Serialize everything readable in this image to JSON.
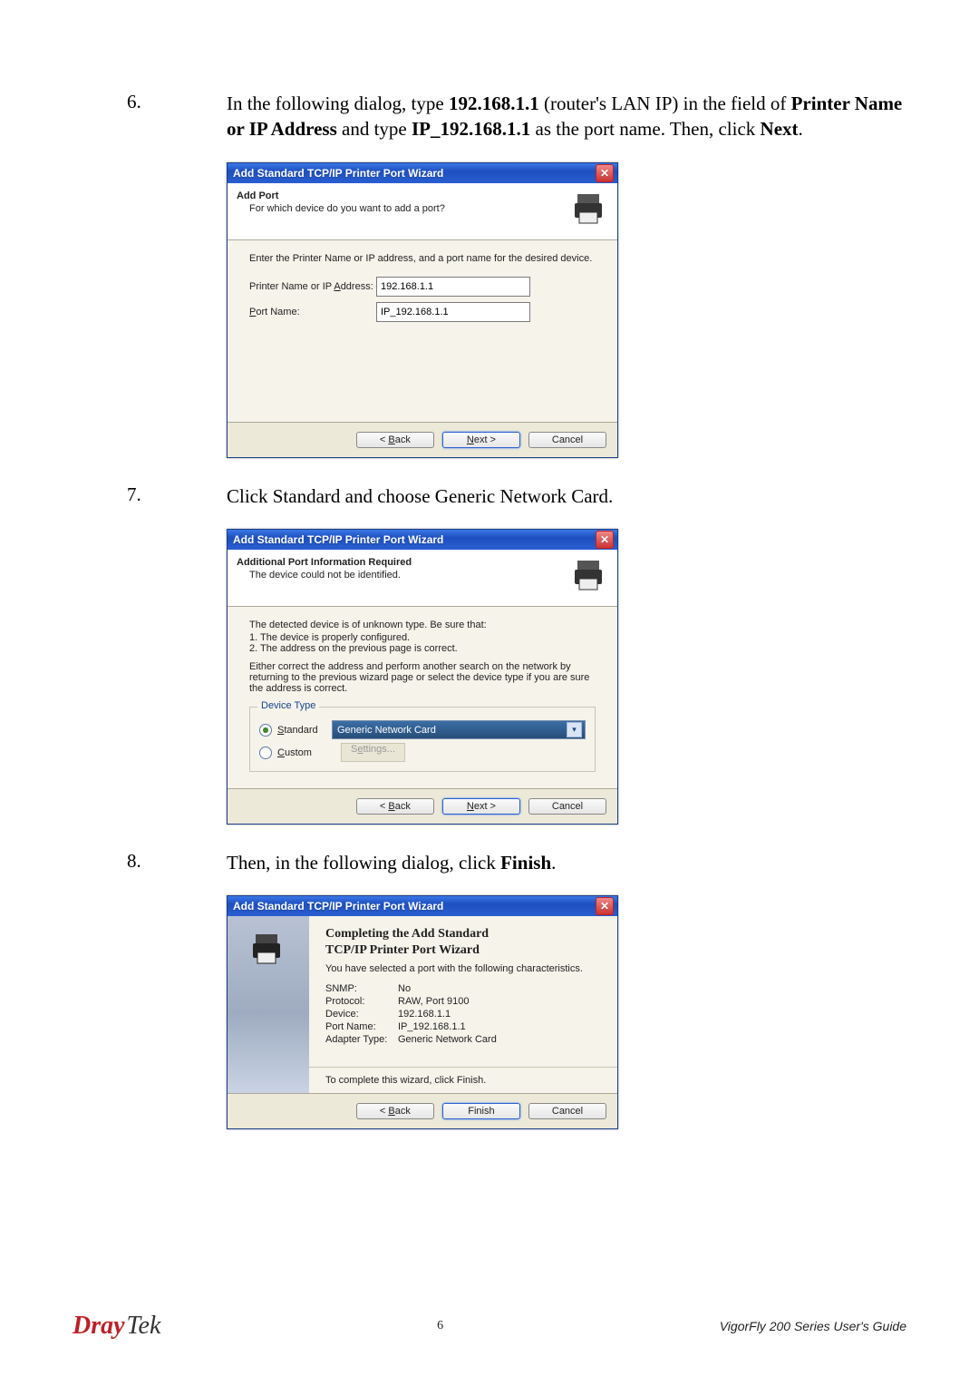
{
  "step6": {
    "num": "6.",
    "text_pre": "In the following dialog, type ",
    "ip": "192.168.1.1",
    "text_mid1": " (router's LAN IP) in the field of ",
    "bold1": "Printer Name or IP Address",
    "text_mid2": " and type ",
    "bold2": "IP_192.168.1.1",
    "text_mid3": " as the port name. Then, click ",
    "bold3": "Next",
    "period": "."
  },
  "step7": {
    "num": "7.",
    "text": "Click Standard and choose Generic Network Card."
  },
  "step8": {
    "num": "8.",
    "text_pre": "Then, in the following dialog, click ",
    "bold1": "Finish",
    "period": "."
  },
  "dialog_title": "Add Standard TCP/IP Printer Port Wizard",
  "d1": {
    "header_title": "Add Port",
    "header_sub": "For which device do you want to add a port?",
    "instr": "Enter the Printer Name or IP address, and a port name for the desired device.",
    "lbl_printer_name": "Printer Name or IP Address:",
    "val_printer_name": "192.168.1.1",
    "lbl_port_name": "Port Name:",
    "val_port_name": "IP_192.168.1.1"
  },
  "d2": {
    "header_title": "Additional Port Information Required",
    "header_sub": "The device could not be identified.",
    "para1": "The detected device is of unknown type. Be sure that:",
    "para1a": "1. The device is properly configured.",
    "para1b": "2. The address on the previous page is correct.",
    "para2": "Either correct the address and perform another search on the network by returning to the previous wizard page or select the device type if you are sure the address is correct.",
    "group_label": "Device Type",
    "radio_standard": "Standard",
    "combo_val": "Generic Network Card",
    "radio_custom": "Custom",
    "settings": "Settings..."
  },
  "d3": {
    "h1a": "Completing the Add Standard",
    "h1b": "TCP/IP Printer Port Wizard",
    "intro": "You have selected a port with the following characteristics.",
    "kv": [
      {
        "k": "SNMP:",
        "v": "No"
      },
      {
        "k": "Protocol:",
        "v": "RAW, Port 9100"
      },
      {
        "k": "Device:",
        "v": "192.168.1.1"
      },
      {
        "k": "Port Name:",
        "v": "IP_192.168.1.1"
      },
      {
        "k": "Adapter Type:",
        "v": "Generic Network Card"
      }
    ],
    "complete": "To complete this wizard, click Finish."
  },
  "buttons": {
    "back": "< Back",
    "next": "Next >",
    "finish": "Finish",
    "cancel": "Cancel",
    "back_u_pre": "< ",
    "back_u": "B",
    "back_post": "ack",
    "next_u": "N",
    "next_post": "ext >",
    "u_char": "_"
  },
  "footer": {
    "logo1": "Dray",
    "logo2": "Tek",
    "page": "6",
    "guide": "VigorFly 200 Series User's Guide"
  }
}
